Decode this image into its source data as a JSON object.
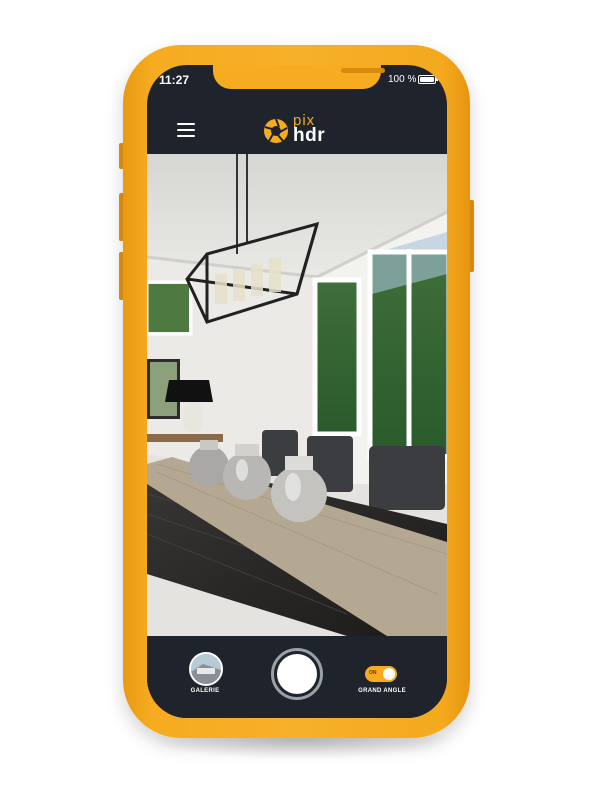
{
  "status_bar": {
    "time": "11:27",
    "battery": "100 %"
  },
  "header": {
    "logo_top": "pix",
    "logo_bottom": "hdr",
    "menu_icon": "hamburger-menu-icon"
  },
  "viewfinder": {
    "subject": "dining room preview"
  },
  "controls": {
    "gallery_label": "GALERIE",
    "wide_angle_label": "GRAND ANGLE",
    "wide_angle_toggle_text": "ON",
    "wide_angle_on": true
  },
  "colors": {
    "accent": "#f6ab20",
    "screen": "#1f242c"
  }
}
